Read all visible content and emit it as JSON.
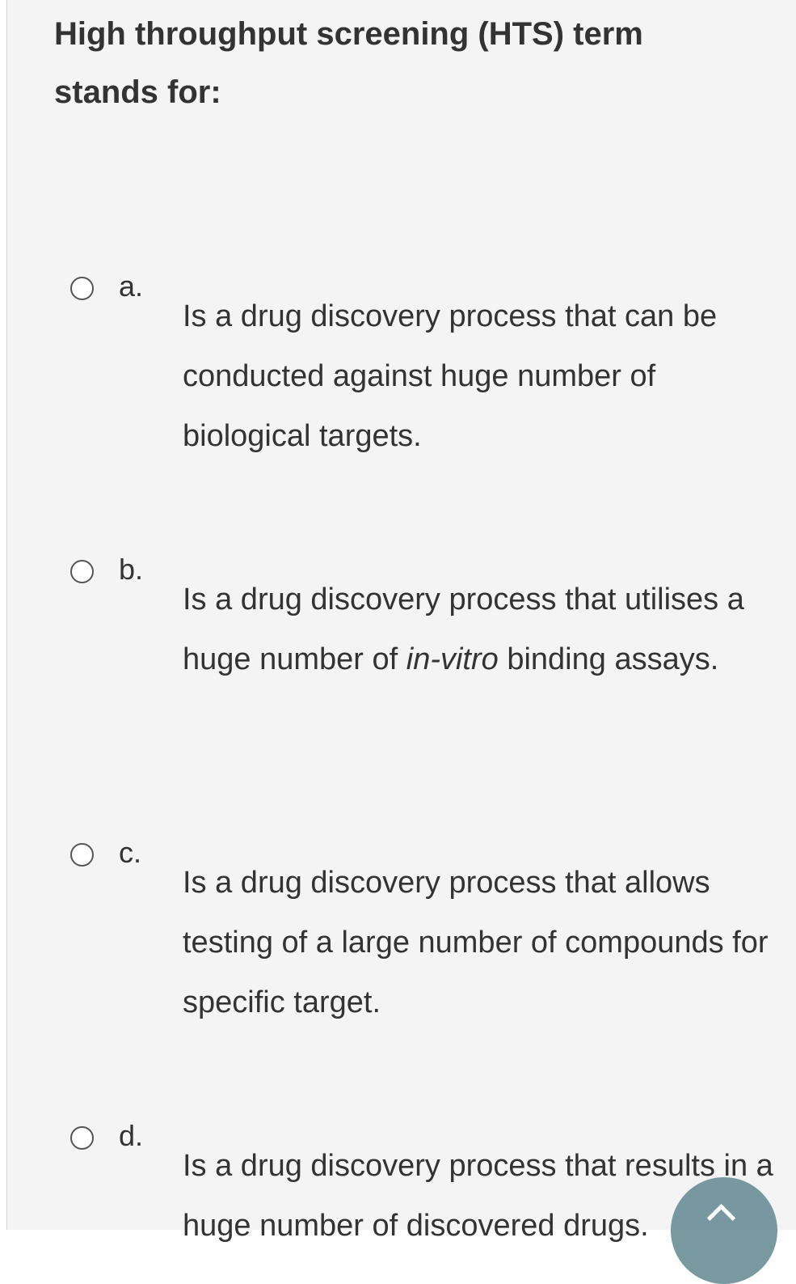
{
  "question": {
    "text": "High throughput screening (HTS) term stands for:"
  },
  "options": [
    {
      "letter": "a.",
      "text_before": "Is a drug discovery process that can be conducted against huge number of biological targets.",
      "italic": "",
      "text_after": ""
    },
    {
      "letter": "b.",
      "text_before": "Is a drug discovery process that utilises a huge number of ",
      "italic": "in-vitro",
      "text_after": " binding assays."
    },
    {
      "letter": "c.",
      "text_before": "Is a drug discovery process that allows testing of a large number of compounds for specific target.",
      "italic": "",
      "text_after": ""
    },
    {
      "letter": "d.",
      "text_before": "Is a drug discovery process that results in a huge number of discovered drugs.",
      "italic": "",
      "text_after": ""
    }
  ],
  "icons": {
    "scroll_top": "chevron-up-icon"
  },
  "colors": {
    "panel_bg": "#f4f4f4",
    "text": "#333333",
    "fab_bg": "#6d9199"
  }
}
